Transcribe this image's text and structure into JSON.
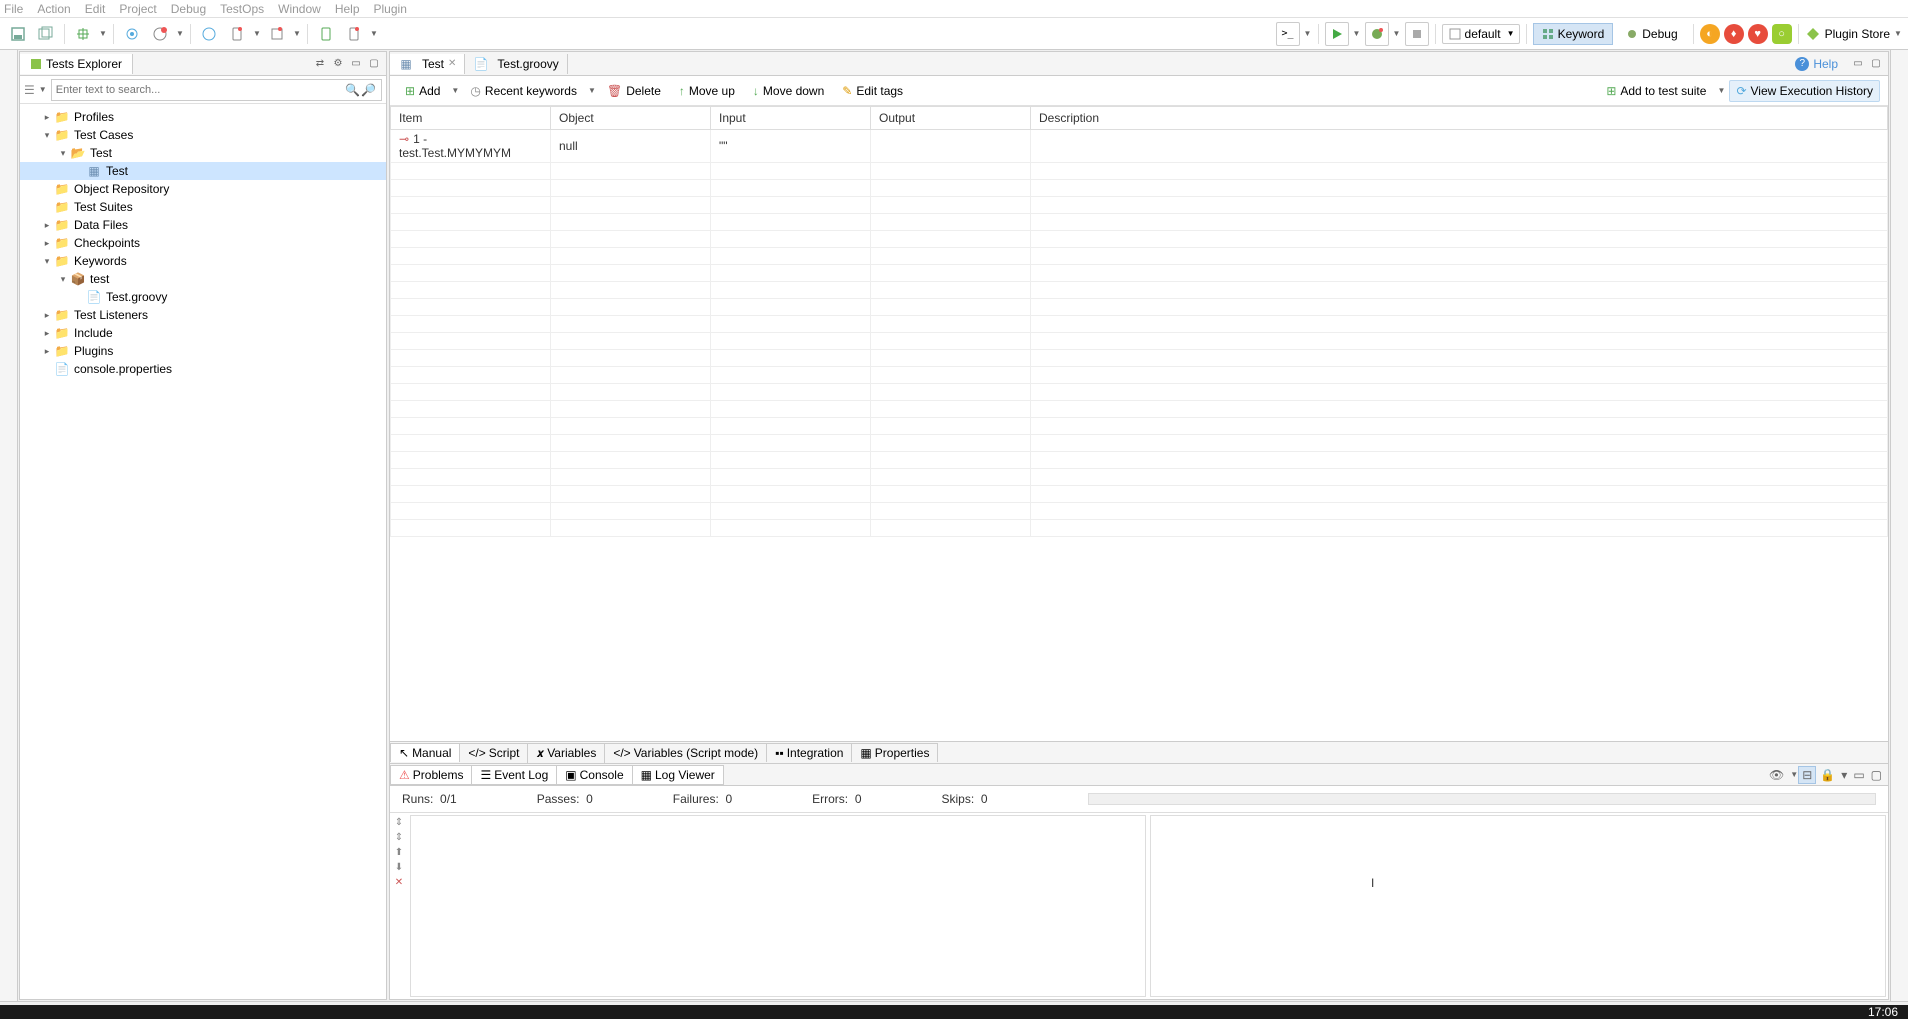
{
  "menu": [
    "File",
    "Action",
    "Edit",
    "Project",
    "Debug",
    "TestOps",
    "Window",
    "Help",
    "Plugin"
  ],
  "toolbar": {
    "profile": "default",
    "keyword_mode": "Keyword",
    "debug_mode": "Debug",
    "plugin_store": "Plugin Store"
  },
  "explorer": {
    "title": "Tests Explorer",
    "search_placeholder": "Enter text to search...",
    "tree": {
      "profiles": "Profiles",
      "test_cases": "Test Cases",
      "test_folder": "Test",
      "test_item": "Test",
      "object_repo": "Object Repository",
      "test_suites": "Test Suites",
      "data_files": "Data Files",
      "checkpoints": "Checkpoints",
      "keywords": "Keywords",
      "test_pkg": "test",
      "groovy_file": "Test.groovy",
      "test_listeners": "Test Listeners",
      "include": "Include",
      "plugins": "Plugins",
      "console_props": "console.properties"
    }
  },
  "editor": {
    "tab1": "Test",
    "tab2": "Test.groovy",
    "help": "Help"
  },
  "actions": {
    "add": "Add",
    "recent": "Recent keywords",
    "delete": "Delete",
    "moveup": "Move up",
    "movedown": "Move down",
    "edittags": "Edit tags",
    "addtosuite": "Add to test suite",
    "viewhistory": "View Execution History"
  },
  "table": {
    "headers": {
      "item": "Item",
      "object": "Object",
      "input": "Input",
      "output": "Output",
      "description": "Description"
    },
    "row1": {
      "item": "1 - test.Test.MYMYMYM",
      "object": "null",
      "input": "\"\"",
      "output": "",
      "description": ""
    }
  },
  "bottom_tabs": {
    "manual": "Manual",
    "script": "Script",
    "variables": "Variables",
    "vars_script": "Variables (Script mode)",
    "integration": "Integration",
    "properties": "Properties"
  },
  "log_tabs": {
    "problems": "Problems",
    "eventlog": "Event Log",
    "console": "Console",
    "logviewer": "Log Viewer"
  },
  "log_stats": {
    "runs_label": "Runs:",
    "runs_val": "0/1",
    "passes_label": "Passes:",
    "passes_val": "0",
    "failures_label": "Failures:",
    "failures_val": "0",
    "errors_label": "Errors:",
    "errors_val": "0",
    "skips_label": "Skips:",
    "skips_val": "0"
  },
  "taskbar": {
    "time": "17:06"
  }
}
